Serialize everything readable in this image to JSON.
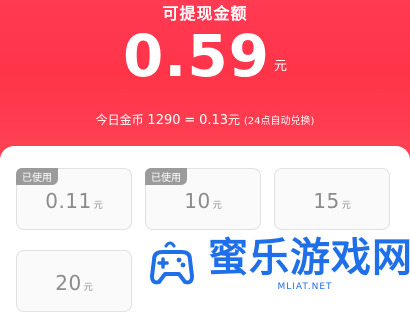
{
  "header": {
    "title": "可提现金额",
    "amount": "0.59",
    "amount_unit": "元",
    "coins_prefix": "今日金币",
    "coins_value": "1290",
    "coins_equals": "=",
    "coins_cash": "0.13",
    "coins_cash_unit": "元",
    "coins_note": "(24点自动兑换)"
  },
  "options": [
    {
      "value": "0.11",
      "unit": "元",
      "badge": "已使用"
    },
    {
      "value": "10",
      "unit": "元",
      "badge": "已使用"
    },
    {
      "value": "15",
      "unit": "元",
      "badge": ""
    },
    {
      "value": "20",
      "unit": "元",
      "badge": ""
    }
  ],
  "watermark": {
    "text": "蜜乐游戏网",
    "url": "MLIAT.NET",
    "icon": "gamepad-icon"
  },
  "colors": {
    "header_red": "#ff3a52",
    "badge_gray": "#9b9b9b",
    "watermark_blue": "#1e6fe8"
  }
}
